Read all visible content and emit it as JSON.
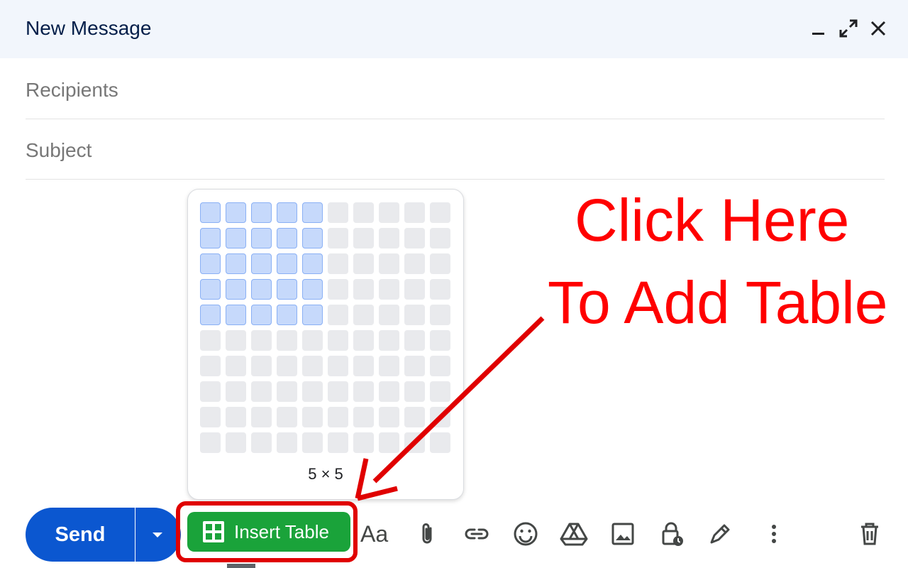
{
  "header": {
    "title": "New Message"
  },
  "fields": {
    "recipients_placeholder": "Recipients",
    "subject_placeholder": "Subject"
  },
  "table_picker": {
    "rows": 10,
    "cols": 10,
    "selected_rows": 5,
    "selected_cols": 5,
    "size_label": "5 × 5"
  },
  "toolbar": {
    "send_label": "Send",
    "insert_table_label": "Insert Table",
    "format_label": "Aa",
    "icons": [
      "attach-icon",
      "link-icon",
      "emoji-icon",
      "drive-icon",
      "photo-icon",
      "confidential-icon",
      "signature-icon",
      "more-icon",
      "trash-icon"
    ]
  },
  "annotation": {
    "line1": "Click Here",
    "line2": "To Add Table",
    "color": "#ff0000"
  },
  "colors": {
    "header_bg": "#f2f6fc",
    "send_bg": "#0b57d0",
    "insert_bg": "#1aa33a",
    "selected_cell": "#c6d9fb"
  }
}
